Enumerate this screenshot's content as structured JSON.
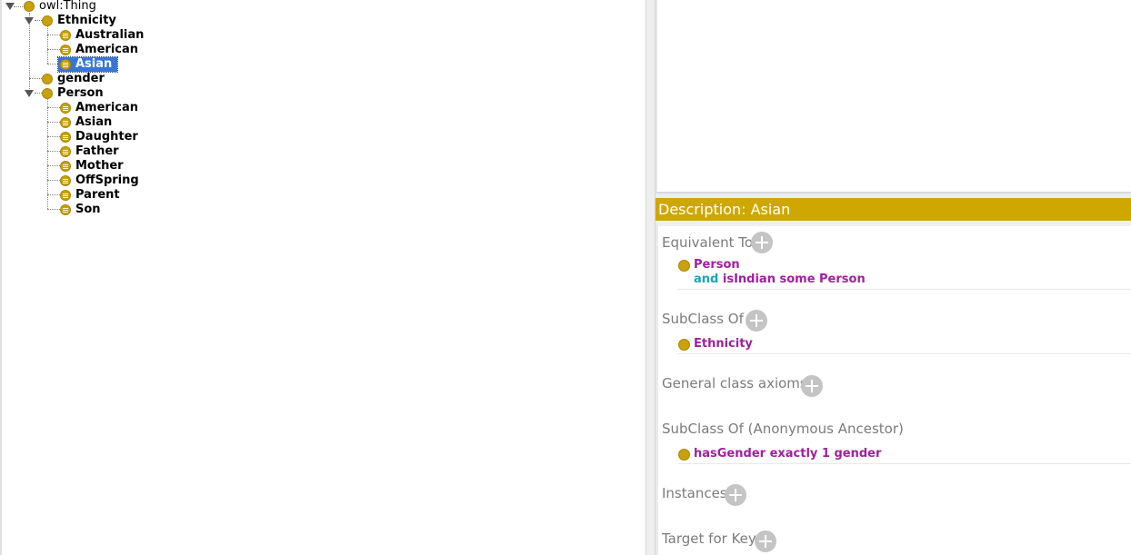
{
  "tree": {
    "root": "owl:Thing",
    "ethnicity": {
      "label": "Ethnicity",
      "children": [
        "Australian",
        "American",
        "Asian"
      ]
    },
    "gender": "gender",
    "person": {
      "label": "Person",
      "children": [
        "American",
        "Asian",
        "Daughter",
        "Father",
        "Mother",
        "OffSpring",
        "Parent",
        "Son"
      ]
    },
    "selected": "Asian"
  },
  "description": {
    "header": "Description: Asian",
    "equivalent_to": {
      "title": "Equivalent To",
      "line1": "Person",
      "line2_op": "and",
      "line2_rest": "isIndian some Person"
    },
    "subclass_of": {
      "title": "SubClass Of",
      "item": "Ethnicity"
    },
    "general_axioms": {
      "title": "General class axioms"
    },
    "anon_ancestor": {
      "title": "SubClass Of (Anonymous Ancestor)",
      "item": "hasGender exactly 1 gender"
    },
    "instances": {
      "title": "Instances"
    },
    "target_for_key": {
      "title": "Target for Key"
    }
  },
  "colors": {
    "header_bg": "#cea700",
    "class_icon": "#c9a10c",
    "selection": "#3875d7",
    "keyword_class": "#a0209e",
    "keyword_operator": "#18a6b8"
  },
  "icons": {
    "class": "class-circle-icon",
    "defined_class": "defined-class-icon",
    "expand": "expand-triangle-icon",
    "add": "add-plus-icon"
  }
}
